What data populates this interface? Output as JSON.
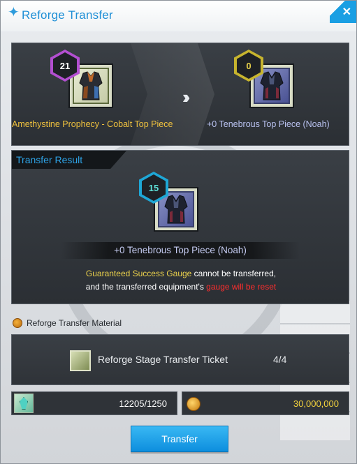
{
  "window": {
    "title": "Reforge Transfer",
    "close_symbol": "✕"
  },
  "source": {
    "level": "21",
    "name": "Amethystine Prophecy - Cobalt Top Piece",
    "badge_color": "#b34fd1"
  },
  "target": {
    "level": "0",
    "name": "+0 Tenebrous Top Piece (Noah)",
    "badge_color": "#c7b42e"
  },
  "result": {
    "tab_label": "Transfer Result",
    "level": "15",
    "name": "+0 Tenebrous Top Piece (Noah)",
    "badge_color": "#1ea7d6",
    "notice_line1_highlight": "Guaranteed Success Gauge",
    "notice_line1_rest": " cannot be transferred,",
    "notice_line2_start": "and the transferred equipment's ",
    "notice_line2_warning": "gauge will be reset"
  },
  "material": {
    "section_label": "Reforge Transfer  Material",
    "ticket_name": "Reforge Stage Transfer Ticket",
    "ticket_count": "4/4"
  },
  "costs": {
    "crystal_value": "12205/1250",
    "gold_value": "30,000,000"
  },
  "actions": {
    "transfer_label": "Transfer"
  },
  "colors": {
    "accent": "#1f8fd6",
    "gold_text": "#ecd24c",
    "warning_text": "#ff2d2d"
  }
}
